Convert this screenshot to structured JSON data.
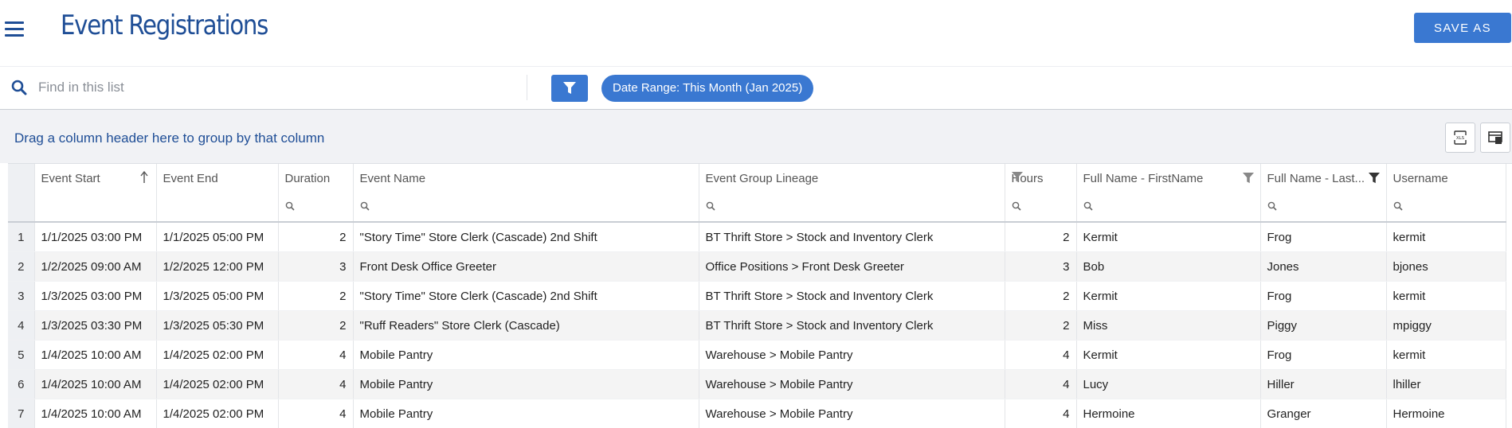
{
  "header": {
    "title": "Event Registrations",
    "save_as_label": "SAVE AS",
    "menu_icon": "hamburger-menu-icon"
  },
  "search": {
    "placeholder": "Find in this list",
    "value": "",
    "icon": "search-icon"
  },
  "filters": {
    "filter_icon": "funnel-icon",
    "chip_label": "Date Range: This Month (Jan 2025)"
  },
  "group_bar": {
    "hint": "Drag a column header here to group by that column",
    "export_icon": "export-xls-icon",
    "columns_icon": "column-chooser-icon"
  },
  "colors": {
    "brand": "#1f4e96",
    "accent": "#3a78d1",
    "group_bar_bg": "#f1f2f5"
  },
  "grid": {
    "columns": [
      {
        "label": "Event Start",
        "sorted": "ascending"
      },
      {
        "label": "Event End"
      },
      {
        "label": "Duration",
        "align": "right"
      },
      {
        "label": "Event Name"
      },
      {
        "label": "Event Group Lineage"
      },
      {
        "label": "Hours",
        "align": "right",
        "filter_icon": true
      },
      {
        "label": "Full Name - FirstName",
        "filter_icon": true
      },
      {
        "label": "Full Name - Last...",
        "filter_icon": true,
        "filter_active": true
      },
      {
        "label": "Username"
      }
    ],
    "rows": [
      {
        "n": "1",
        "start": "1/1/2025 03:00 PM",
        "end": "1/1/2025 05:00 PM",
        "duration": "2",
        "name": "\"Story Time\" Store Clerk (Cascade) 2nd Shift",
        "lineage": "BT Thrift Store > Stock and Inventory Clerk",
        "hours": "2",
        "first": "Kermit",
        "last": "Frog",
        "user": "kermit"
      },
      {
        "n": "2",
        "start": "1/2/2025 09:00 AM",
        "end": "1/2/2025 12:00 PM",
        "duration": "3",
        "name": "Front Desk Office Greeter",
        "lineage": "Office Positions > Front Desk Greeter",
        "hours": "3",
        "first": "Bob",
        "last": "Jones",
        "user": "bjones"
      },
      {
        "n": "3",
        "start": "1/3/2025 03:00 PM",
        "end": "1/3/2025 05:00 PM",
        "duration": "2",
        "name": "\"Story Time\" Store Clerk (Cascade) 2nd Shift",
        "lineage": "BT Thrift Store > Stock and Inventory Clerk",
        "hours": "2",
        "first": "Kermit",
        "last": "Frog",
        "user": "kermit"
      },
      {
        "n": "4",
        "start": "1/3/2025 03:30 PM",
        "end": "1/3/2025 05:30 PM",
        "duration": "2",
        "name": "\"Ruff Readers\" Store Clerk (Cascade)",
        "lineage": "BT Thrift Store > Stock and Inventory Clerk",
        "hours": "2",
        "first": "Miss",
        "last": "Piggy",
        "user": "mpiggy"
      },
      {
        "n": "5",
        "start": "1/4/2025 10:00 AM",
        "end": "1/4/2025 02:00 PM",
        "duration": "4",
        "name": "Mobile Pantry",
        "lineage": "Warehouse > Mobile Pantry",
        "hours": "4",
        "first": "Kermit",
        "last": "Frog",
        "user": "kermit"
      },
      {
        "n": "6",
        "start": "1/4/2025 10:00 AM",
        "end": "1/4/2025 02:00 PM",
        "duration": "4",
        "name": "Mobile Pantry",
        "lineage": "Warehouse > Mobile Pantry",
        "hours": "4",
        "first": "Lucy",
        "last": "Hiller",
        "user": "lhiller"
      },
      {
        "n": "7",
        "start": "1/4/2025 10:00 AM",
        "end": "1/4/2025 02:00 PM",
        "duration": "4",
        "name": "Mobile Pantry",
        "lineage": "Warehouse > Mobile Pantry",
        "hours": "4",
        "first": "Hermoine",
        "last": "Granger",
        "user": "Hermoine"
      }
    ]
  }
}
